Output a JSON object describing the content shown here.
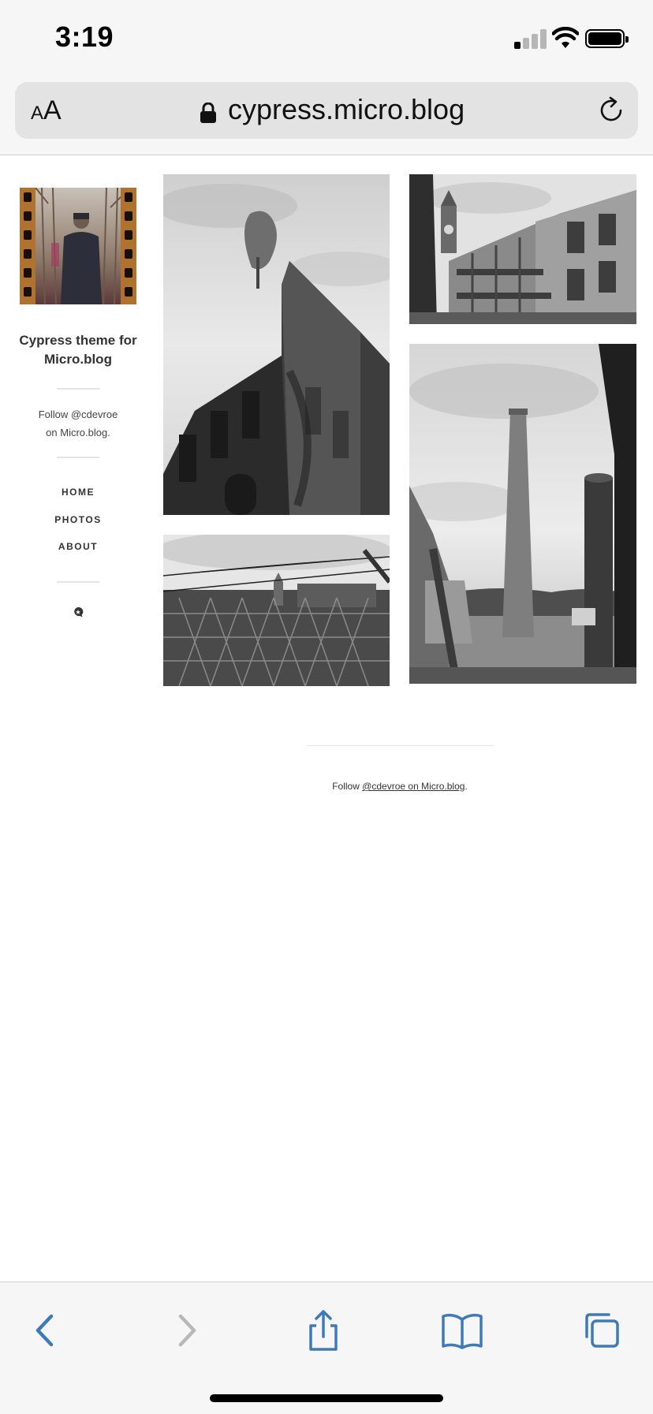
{
  "status_bar": {
    "time": "3:19",
    "signal_bars_active": 1,
    "signal_bars_total": 4
  },
  "browser": {
    "text_size_small": "A",
    "text_size_large": "A",
    "url": "cypress.micro.blog"
  },
  "sidebar": {
    "site_title": "Cypress theme for Micro.blog",
    "follow_line1": "Follow @cdevroe",
    "follow_line2": "on Micro.blog.",
    "nav": [
      {
        "label": "HOME"
      },
      {
        "label": "PHOTOS"
      },
      {
        "label": "ABOUT"
      }
    ]
  },
  "footer": {
    "prefix": "Follow ",
    "link_text": "@cdevroe on Micro.blog",
    "suffix": "."
  },
  "toolbar": {
    "icons": [
      "back-icon",
      "forward-icon",
      "share-icon",
      "bookmarks-icon",
      "tabs-icon"
    ],
    "accent_color": "#3e7ab8",
    "disabled_color": "#b8b8b8"
  }
}
